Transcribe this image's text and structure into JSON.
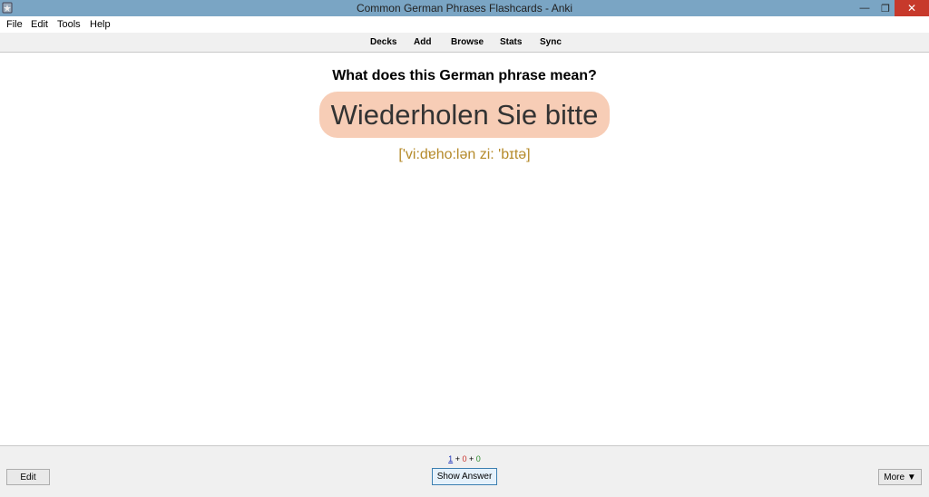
{
  "window": {
    "title": "Common German Phrases Flashcards - Anki",
    "minimize_glyph": "—",
    "maximize_glyph": "❐",
    "close_glyph": "✕"
  },
  "menu": {
    "items": [
      "File",
      "Edit",
      "Tools",
      "Help"
    ]
  },
  "toolbar": {
    "links": [
      "Decks",
      "Add",
      "Browse",
      "Stats",
      "Sync"
    ]
  },
  "card": {
    "question": "What does this German phrase mean?",
    "phrase": "Wiederholen Sie bitte",
    "pronunciation": "['vi:dɐho:lən zi: 'bɪtə]",
    "phrase_bg_color": "#f7cdb6",
    "pronunciation_color": "#b58a2a"
  },
  "bottom": {
    "counts": {
      "new": "1",
      "learning": "0",
      "review": "0",
      "separator": "+"
    },
    "edit_label": "Edit",
    "show_answer_label": "Show Answer",
    "more_label": "More ▼"
  },
  "colors": {
    "titlebar": "#7aa5c4",
    "close_button": "#c7392b",
    "new_count": "#1a2fb8",
    "learning_count": "#c8302a",
    "review_count": "#2a8a2a"
  }
}
